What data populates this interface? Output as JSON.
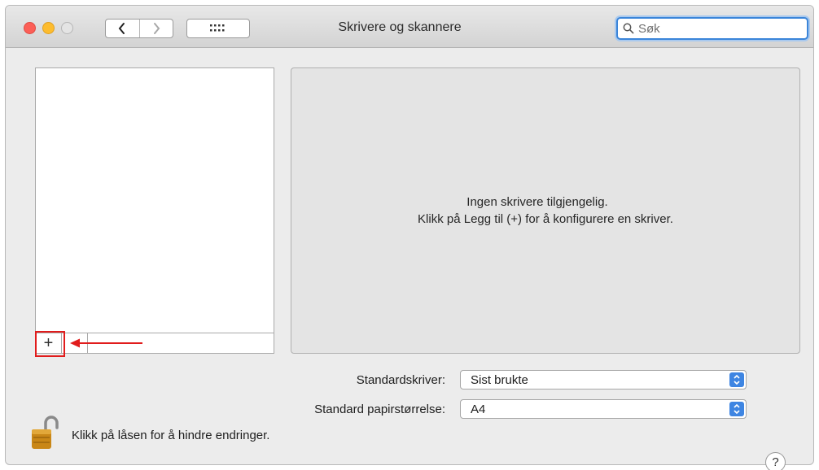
{
  "window": {
    "title": "Skrivere og skannere",
    "nav": {
      "back_icon": "chevron-left-icon",
      "forward_icon": "chevron-right-icon",
      "grid_icon": "grid-icon"
    }
  },
  "search": {
    "placeholder": "Søk",
    "value": ""
  },
  "printer_list": {
    "items": [],
    "add_label": "+",
    "remove_label": ""
  },
  "detail": {
    "empty_line1": "Ingen skrivere tilgjengelig.",
    "empty_line2": "Klikk på Legg til (+) for å konfigurere en skriver."
  },
  "settings": {
    "default_printer": {
      "label": "Standardskriver:",
      "value": "Sist brukte"
    },
    "paper_size": {
      "label": "Standard papirstørrelse:",
      "value": "A4"
    }
  },
  "lock": {
    "text": "Klikk på låsen for å hindre endringer.",
    "icon": "lock-open-icon"
  },
  "help": {
    "label": "?"
  },
  "colors": {
    "highlight": "#e11c1c",
    "accent": "#3e85e2",
    "close": "#fc5f57",
    "minimize": "#fdbc2e"
  }
}
